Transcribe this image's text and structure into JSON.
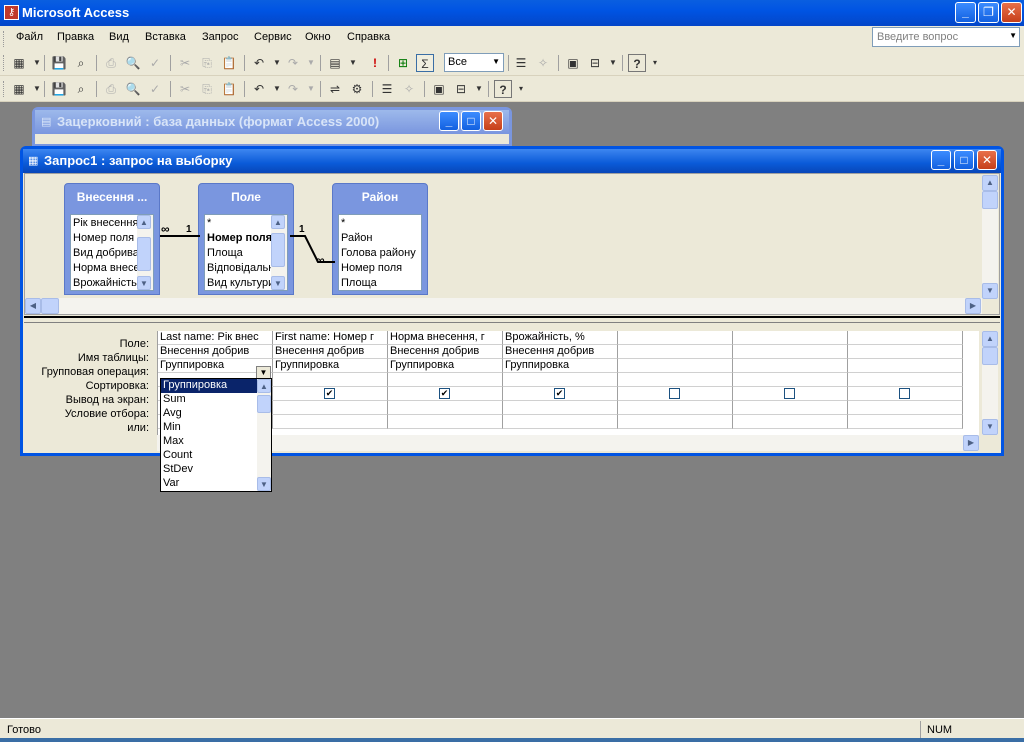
{
  "app": {
    "title": "Microsoft Access"
  },
  "menu": {
    "items": [
      "Файл",
      "Правка",
      "Вид",
      "Вставка",
      "Запрос",
      "Сервис",
      "Окно",
      "Справка"
    ],
    "ask_placeholder": "Введите вопрос"
  },
  "toolbar": {
    "filter_value": "Все"
  },
  "db_window": {
    "title": "Зацерковний : база данных (формат Access 2000)"
  },
  "query_window": {
    "title": "Запрос1 : запрос на выборку"
  },
  "tables": [
    {
      "name": "Внесення ...",
      "fields": [
        "Рік внесення",
        "Номер поля",
        "Вид добрива",
        "Норма внесен",
        "Врожайність,"
      ]
    },
    {
      "name": "Поле",
      "fields": [
        "*",
        "Номер поля",
        "Площа",
        "Відповідальн",
        "Вид культури"
      ]
    },
    {
      "name": "Район",
      "fields": [
        "*",
        "Район",
        "Голова району",
        "Номер поля",
        "Площа"
      ]
    }
  ],
  "relations": [
    {
      "from_label": "∞",
      "to_label": "1"
    },
    {
      "from_label": "1",
      "to_label": "∞"
    }
  ],
  "grid": {
    "row_labels": [
      "Поле:",
      "Имя таблицы:",
      "Групповая операция:",
      "Сортировка:",
      "Вывод на экран:",
      "Условие отбора:",
      "или:"
    ],
    "columns": [
      {
        "field": "Last name: Рік внес",
        "table": "Внесення добрив",
        "group": "Группировка",
        "show": true
      },
      {
        "field": "First name: Номер г",
        "table": "Внесення добрив",
        "group": "Группировка",
        "show": true
      },
      {
        "field": "Норма внесення, г",
        "table": "Внесення добрив",
        "group": "Группировка",
        "show": true
      },
      {
        "field": "Врожайність, %",
        "table": "Внесення добрив",
        "group": "Группировка",
        "show": true
      },
      {
        "field": "",
        "table": "",
        "group": "",
        "show": false
      },
      {
        "field": "",
        "table": "",
        "group": "",
        "show": false
      },
      {
        "field": "",
        "table": "",
        "group": "",
        "show": false
      }
    ]
  },
  "dropdown": {
    "options": [
      "Группировка",
      "Sum",
      "Avg",
      "Min",
      "Max",
      "Count",
      "StDev",
      "Var"
    ],
    "selected": "Группировка"
  },
  "status": {
    "left": "Готово",
    "num": "NUM"
  }
}
